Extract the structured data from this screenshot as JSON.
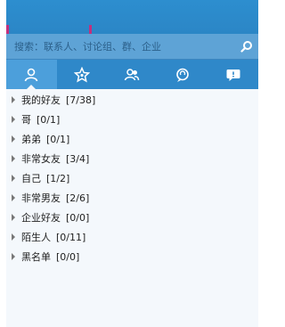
{
  "search": {
    "placeholder": "搜索：联系人、讨论组、群、企业"
  },
  "tabs": [
    {
      "icon": "contact-icon",
      "active": true
    },
    {
      "icon": "star-icon",
      "active": false
    },
    {
      "icon": "group-icon",
      "active": false
    },
    {
      "icon": "chat-icon",
      "active": false
    },
    {
      "icon": "message-icon",
      "active": false
    }
  ],
  "groups": [
    {
      "name": "我的好友",
      "count": "[7/38]"
    },
    {
      "name": "哥",
      "count": "[0/1]"
    },
    {
      "name": "弟弟",
      "count": "[0/1]"
    },
    {
      "name": "非常女友",
      "count": "[3/4]"
    },
    {
      "name": "自己",
      "count": "[1/2]"
    },
    {
      "name": "非常男友",
      "count": "[2/6]"
    },
    {
      "name": "企业好友",
      "count": "[0/0]"
    },
    {
      "name": "陌生人",
      "count": "[0/11]"
    },
    {
      "name": "黑名单",
      "count": "[0/0]"
    }
  ],
  "colors": {
    "header_blue": "#2b86c6",
    "search_bar": "#5ea3d6",
    "highlight_box": "#c2307d"
  }
}
